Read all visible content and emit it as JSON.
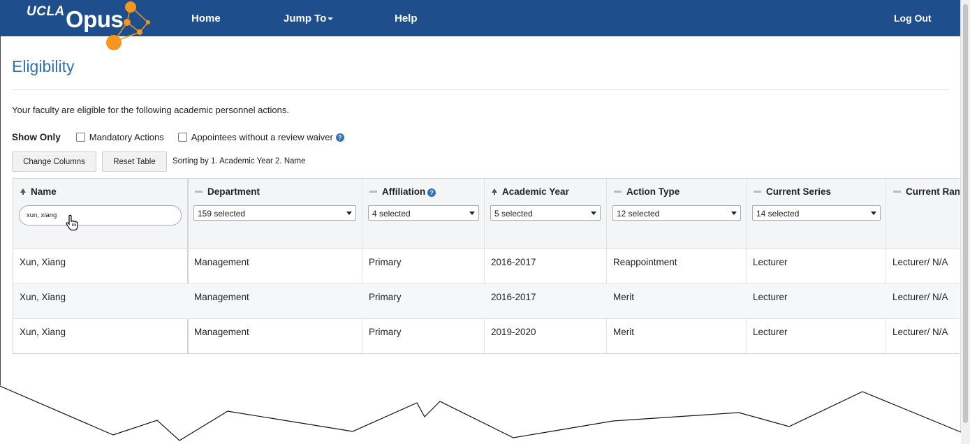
{
  "nav": {
    "logo_ucla": "UCLA",
    "logo_opus": "Opus",
    "home": "Home",
    "jump_to": "Jump To",
    "help": "Help",
    "logout": "Log Out"
  },
  "page": {
    "title": "Eligibility",
    "intro": "Your faculty are eligible for the following academic personnel actions.",
    "show_only": "Show Only",
    "filter_mandatory": "Mandatory Actions",
    "filter_no_waiver": "Appointees without a review waiver",
    "help_glyph": "?",
    "btn_change_columns": "Change Columns",
    "btn_reset_table": "Reset Table",
    "sorting_text": "Sorting by 1. Academic Year 2. Name"
  },
  "table": {
    "columns": [
      {
        "label": "Name",
        "sort": "asc"
      },
      {
        "label": "Department",
        "sort": "none",
        "filter": "159 selected"
      },
      {
        "label": "Affiliation",
        "sort": "none",
        "filter": "4 selected"
      },
      {
        "label": "Academic Year",
        "sort": "asc",
        "filter": "5 selected"
      },
      {
        "label": "Action Type",
        "sort": "none",
        "filter": "12 selected"
      },
      {
        "label": "Current Series",
        "sort": "none",
        "filter": "14 selected"
      },
      {
        "label": "Current Rank",
        "sort": "none"
      }
    ],
    "name_filter_value": "xun, xiang",
    "rows": [
      [
        "Xun, Xiang",
        "Management",
        "Primary",
        "2016-2017",
        "Reappointment",
        "Lecturer",
        "Lecturer/ N/A"
      ],
      [
        "Xun, Xiang",
        "Management",
        "Primary",
        "2016-2017",
        "Merit",
        "Lecturer",
        "Lecturer/ N/A"
      ],
      [
        "Xun, Xiang",
        "Management",
        "Primary",
        "2019-2020",
        "Merit",
        "Lecturer",
        "Lecturer/ N/A"
      ]
    ]
  },
  "icons": {
    "logo": "ucla-opus-logo",
    "cursor": "hand-pointer-cursor",
    "sort": "sort-ascending-icon"
  },
  "colors": {
    "navbar": "#1f4e8c",
    "title": "#2f72b6",
    "logo_orange": "#f5961e"
  }
}
